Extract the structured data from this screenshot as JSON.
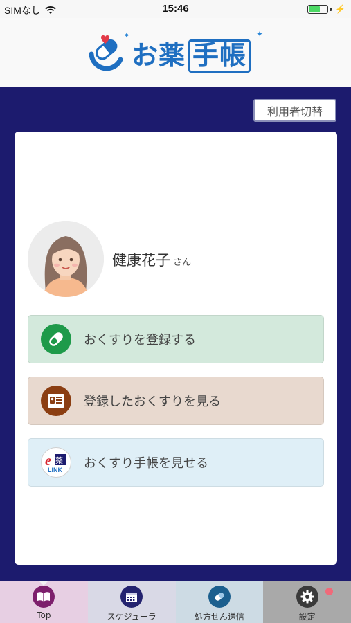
{
  "status_bar": {
    "carrier": "SIMなし",
    "time": "15:46"
  },
  "header": {
    "logo_text_a": "お薬",
    "logo_text_b": "手帳"
  },
  "switch_user_label": "利用者切替",
  "user": {
    "name": "健康花子",
    "suffix": "さん"
  },
  "actions": {
    "register_label": "おくすりを登録する",
    "view_label": "登録したおくすりを見る",
    "show_label": "おくすり手帳を見せる"
  },
  "tabs": [
    {
      "label": "Top",
      "icon": "book-icon",
      "active": true
    },
    {
      "label": "スケジューラ",
      "icon": "calendar-icon",
      "active": false
    },
    {
      "label": "処方せん送信",
      "icon": "prescription-icon",
      "active": false
    },
    {
      "label": "設定",
      "icon": "gear-icon",
      "active": false
    }
  ],
  "colors": {
    "navy": "#1c1b6e",
    "brand_blue": "#1f6fc1",
    "register_green": "#1e9a4a",
    "view_brown": "#8b3e12",
    "badge_pink": "#f06a7a"
  }
}
